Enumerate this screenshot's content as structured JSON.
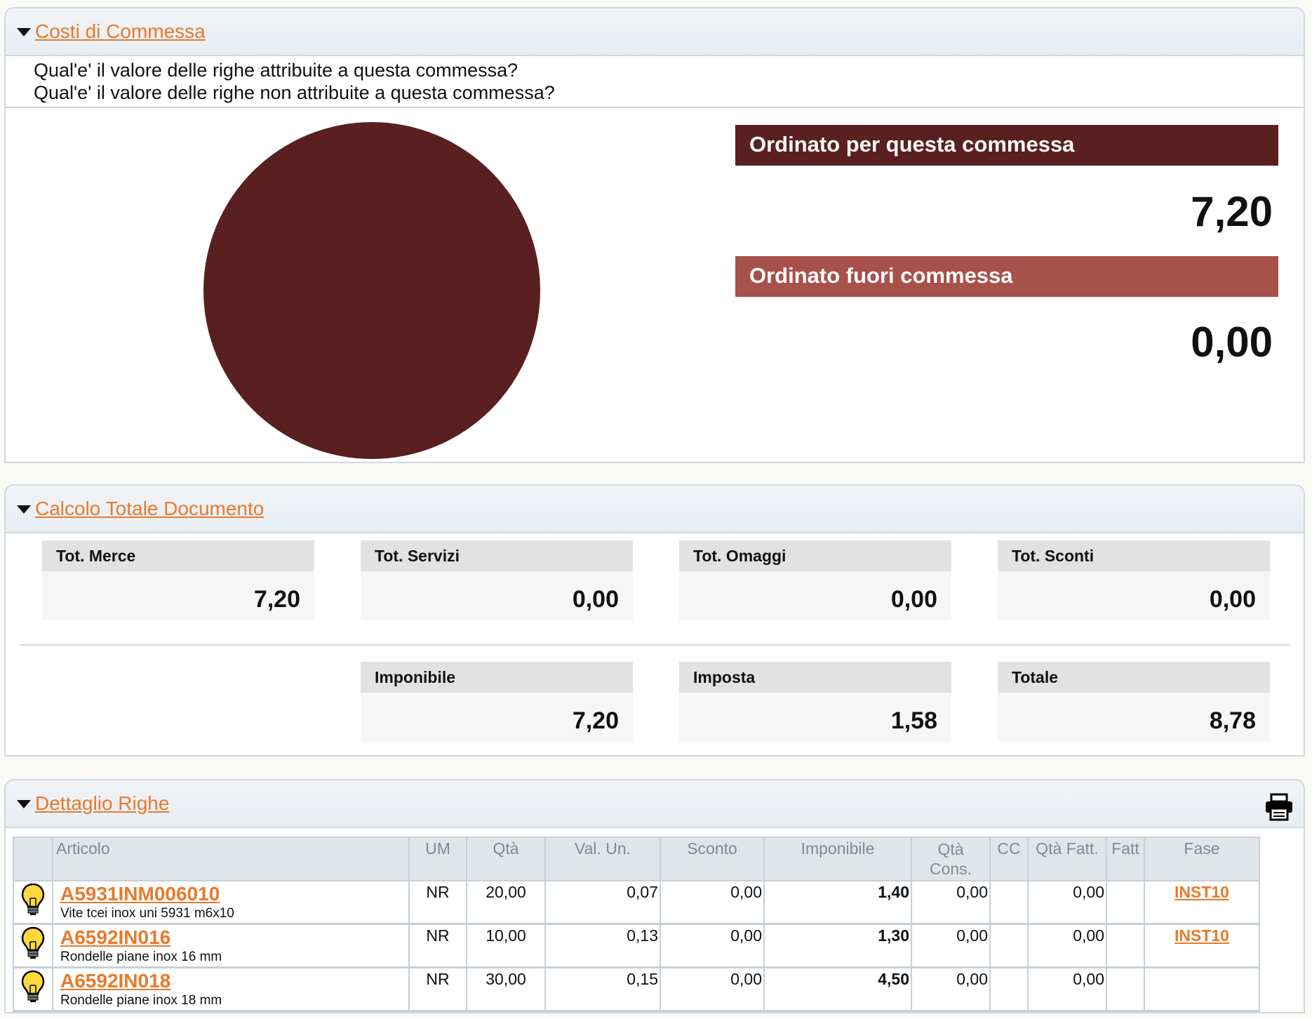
{
  "costi": {
    "title": "Costi di Commessa",
    "questions": [
      "Qual'e' il valore delle righe attribuite a questa commessa?",
      "Qual'e' il valore delle righe non attribuite a questa commessa?"
    ],
    "legend": [
      {
        "label": "Ordinato per questa commessa",
        "value": "7,20",
        "color": "#5a1f1f"
      },
      {
        "label": "Ordinato fuori commessa",
        "value": "0,00",
        "color": "#a8504a"
      }
    ]
  },
  "chart_data": {
    "type": "pie",
    "categories": [
      "Ordinato per questa commessa",
      "Ordinato fuori commessa"
    ],
    "values": [
      7.2,
      0.0
    ],
    "colors": [
      "#5a1f1f",
      "#a8504a"
    ]
  },
  "calcolo": {
    "title": "Calcolo Totale Documento",
    "row1": [
      {
        "label": "Tot. Merce",
        "value": "7,20"
      },
      {
        "label": "Tot. Servizi",
        "value": "0,00"
      },
      {
        "label": "Tot. Omaggi",
        "value": "0,00"
      },
      {
        "label": "Tot. Sconti",
        "value": "0,00"
      }
    ],
    "row2": [
      {
        "label": "Imponibile",
        "value": "7,20"
      },
      {
        "label": "Imposta",
        "value": "1,58"
      },
      {
        "label": "Totale",
        "value": "8,78"
      }
    ]
  },
  "dettaglio": {
    "title": "Dettaglio Righe",
    "columns": {
      "articolo": "Articolo",
      "um": "UM",
      "qta": "Qtà",
      "val_un": "Val. Un.",
      "sconto": "Sconto",
      "imponibile": "Imponibile",
      "qta_cons": "Qtà Cons.",
      "cc": "CC",
      "qta_fatt": "Qtà Fatt.",
      "fatt": "Fatt",
      "fase": "Fase"
    },
    "rows": [
      {
        "code": "A5931INM006010",
        "desc": "Vite tcei inox uni 5931 m6x10",
        "um": "NR",
        "qta": "20,00",
        "val_un": "0,07",
        "sconto": "0,00",
        "imponibile": "1,40",
        "qta_cons": "0,00",
        "cc": "",
        "qta_fatt": "0,00",
        "fatt": "",
        "fase": "INST10"
      },
      {
        "code": "A6592IN016",
        "desc": "Rondelle piane inox 16 mm",
        "um": "NR",
        "qta": "10,00",
        "val_un": "0,13",
        "sconto": "0,00",
        "imponibile": "1,30",
        "qta_cons": "0,00",
        "cc": "",
        "qta_fatt": "0,00",
        "fatt": "",
        "fase": "INST10"
      },
      {
        "code": "A6592IN018",
        "desc": "Rondelle piane inox 18 mm",
        "um": "NR",
        "qta": "30,00",
        "val_un": "0,15",
        "sconto": "0,00",
        "imponibile": "4,50",
        "qta_cons": "0,00",
        "cc": "",
        "qta_fatt": "0,00",
        "fatt": "",
        "fase": ""
      }
    ]
  },
  "icons": {
    "collapse": "triangle-down-icon",
    "printer": "printer-icon",
    "row": "lightbulb-icon"
  }
}
